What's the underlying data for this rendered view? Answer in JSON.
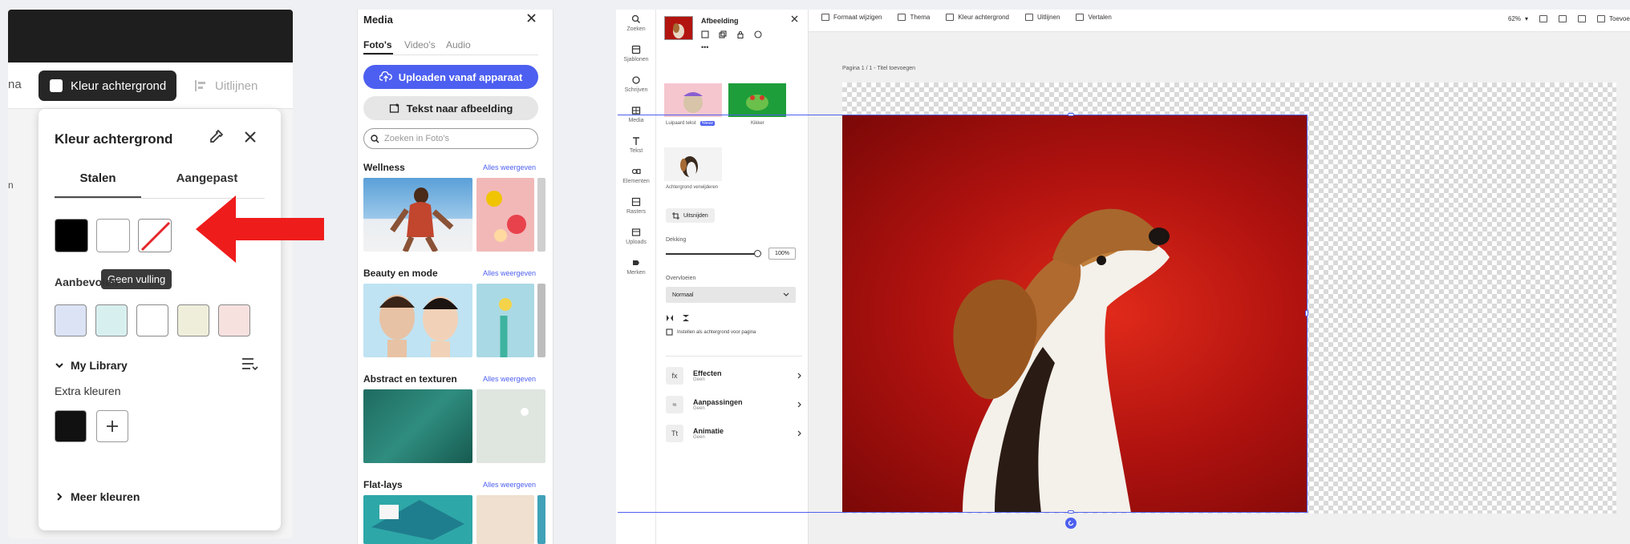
{
  "panel_background": {
    "fragment_left": "na",
    "fragment_left2": "n",
    "toolbar": {
      "bg_button_label": "Kleur achtergrond",
      "align_label": "Uitlijnen"
    },
    "popover": {
      "title": "Kleur achtergrond",
      "tabs": [
        "Stalen",
        "Aangepast"
      ],
      "tooltip": "Geen vulling",
      "recommended_label": "Aanbevolen",
      "recommended_colors": [
        "#dbe3f5",
        "#d7f0ef",
        "#ffffff",
        "#eeeedb",
        "#f6e1df"
      ],
      "swatches": [
        "#000000",
        "#ffffff",
        "none"
      ],
      "library_label": "My Library",
      "extra_label": "Extra kleuren",
      "extra_colors": [
        "#111111"
      ],
      "more_colors": "Meer kleuren"
    },
    "arrow_color": "#ef1c1c"
  },
  "panel_media": {
    "title": "Media",
    "tabs": [
      "Foto's",
      "Video's",
      "Audio"
    ],
    "upload_button": "Uploaden vanaf apparaat",
    "text_to_image_button": "Tekst naar afbeelding",
    "search_placeholder": "Zoeken in Foto's",
    "more_label": "Alles weergeven",
    "sections": [
      {
        "title": "Wellness"
      },
      {
        "title": "Beauty en mode"
      },
      {
        "title": "Abstract en texturen"
      },
      {
        "title": "Flat-lays"
      }
    ]
  },
  "panel_editor": {
    "rail": [
      {
        "icon": "search-icon",
        "label": "Zoeken"
      },
      {
        "icon": "templates-icon",
        "label": "Sjablonen"
      },
      {
        "icon": "text-effects-icon",
        "label": "Schrijven"
      },
      {
        "icon": "media-icon",
        "label": "Media"
      },
      {
        "icon": "text-icon",
        "label": "Tekst"
      },
      {
        "icon": "elements-icon",
        "label": "Elementen"
      },
      {
        "icon": "grid-icon",
        "label": "Rasters"
      },
      {
        "icon": "uploads-icon",
        "label": "Uploads"
      },
      {
        "icon": "brand-icon",
        "label": "Merken"
      }
    ],
    "props": {
      "title": "Afbeelding",
      "thumb1_label": "Luipaard tekst",
      "thumb1_badge": "Nieuw",
      "thumb2_label": "Kikker",
      "thumb3_label": "Achtergrond verwijderen",
      "crop_button": "Uitsnijden",
      "opacity_label": "Dekking",
      "opacity_value": "100%",
      "blend_label": "Overvloeien",
      "blend_value": "Normaal",
      "checkbox_label": "Instellen als achtergrond voor pagina",
      "rows": [
        {
          "title": "Effecten",
          "sub": "Geen"
        },
        {
          "title": "Aanpassingen",
          "sub": "Geen"
        },
        {
          "title": "Animatie",
          "sub": "Geen"
        }
      ]
    },
    "topbar": {
      "items": [
        "Formaat wijzigen",
        "Thema",
        "Kleur achtergrond",
        "Uitlijnen",
        "Vertalen"
      ],
      "zoom": "62%",
      "share": "Toevoegen"
    },
    "page_label": "Pagina 1 / 1 - Titel toevoegen",
    "canvas_bg": "#b0120f",
    "selection_color": "#4d5ff0"
  }
}
